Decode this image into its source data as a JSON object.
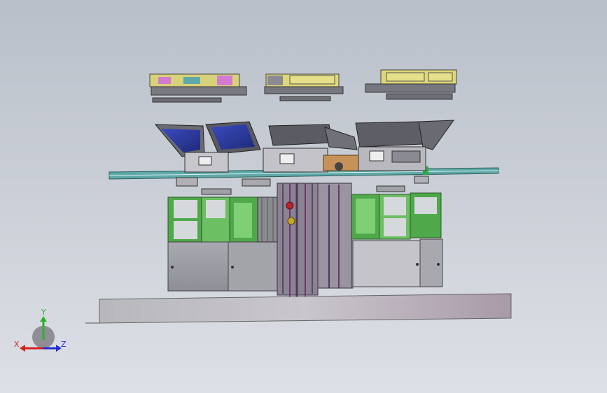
{
  "view": {
    "background_top": "#b9bfc9",
    "background_bottom": "#dde0e6"
  },
  "triad": {
    "x_label": "X",
    "y_label": "Y",
    "z_label": "Z",
    "x_color": "#d42020",
    "y_color": "#2fb02f",
    "z_color": "#2030d0"
  },
  "palette": {
    "frame_green": "#4fa84a",
    "panel_grey": "#9c9ca4",
    "base_grey": "#bdbdc3",
    "tray_blue": "#2f3fa8",
    "rail_teal": "#5fa9a8",
    "slide_yellow": "#d8d27a"
  }
}
